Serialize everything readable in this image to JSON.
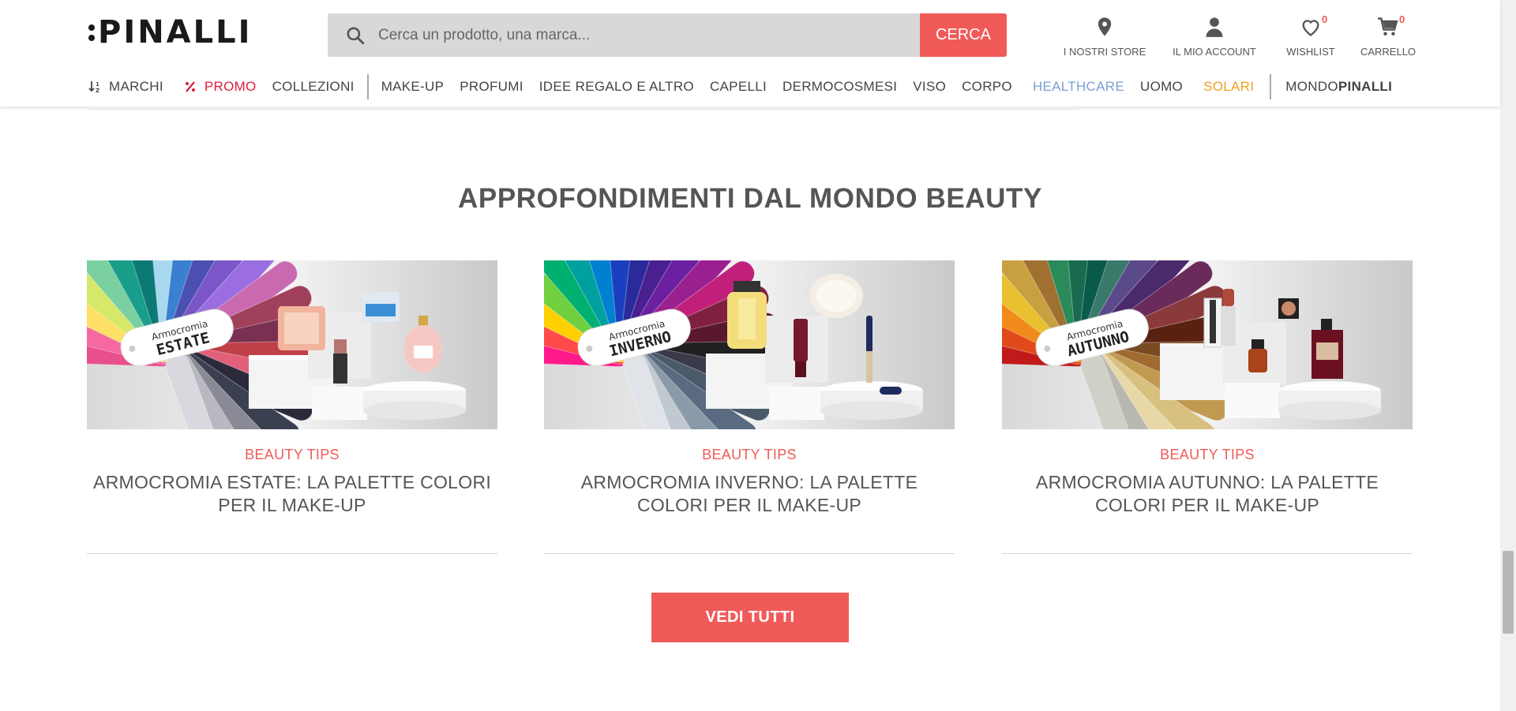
{
  "brand": {
    "logo": "PINALLI"
  },
  "search": {
    "placeholder": "Cerca un prodotto, una marca...",
    "button_label": "CERCA"
  },
  "header_icons": [
    {
      "icon": "map-pin-icon",
      "label": "I NOSTRI STORE"
    },
    {
      "icon": "user-icon",
      "label": "IL MIO ACCOUNT"
    },
    {
      "icon": "heart-icon",
      "label": "WISHLIST",
      "count": "0"
    },
    {
      "icon": "cart-icon",
      "label": "CARRELLO",
      "count": "0"
    }
  ],
  "nav": {
    "marchi": "MARCHI",
    "promo": "PROMO",
    "collezioni": "COLLEZIONI",
    "makeup": "MAKE-UP",
    "profumi": "PROFUMI",
    "idee": "IDEE REGALO E ALTRO",
    "capelli": "CAPELLI",
    "dermo": "DERMOCOSMESI",
    "viso": "VISO",
    "corpo": "CORPO",
    "healthcare": "HEALTHCARE",
    "uomo": "UOMO",
    "solari": "SOLARI",
    "mondo_a": "MONDO",
    "mondo_b": "PINALLI"
  },
  "colors": {
    "accent": "#f05a58",
    "promo": "#e01e3c",
    "healthcare": "#7b9fd6",
    "solari": "#f0a020"
  },
  "section": {
    "title": "APPROFONDIMENTI DAL MONDO BEAUTY"
  },
  "articles": [
    {
      "category": "BEAUTY TIPS",
      "title": "ARMOCROMIA ESTATE: LA PALETTE COLORI PER IL MAKE-UP",
      "tag_small": "Armocromia",
      "tag_big": "ESTATE"
    },
    {
      "category": "BEAUTY TIPS",
      "title": "ARMOCROMIA INVERNO: LA PALETTE COLORI PER IL MAKE-UP",
      "tag_small": "Armocromia",
      "tag_big": "INVERNO"
    },
    {
      "category": "BEAUTY TIPS",
      "title": "ARMOCROMIA AUTUNNO: LA PALETTE COLORI PER IL MAKE-UP",
      "tag_small": "Armocromia",
      "tag_big": "AUTUNNO"
    }
  ],
  "cta": {
    "label": "VEDI TUTTI"
  }
}
